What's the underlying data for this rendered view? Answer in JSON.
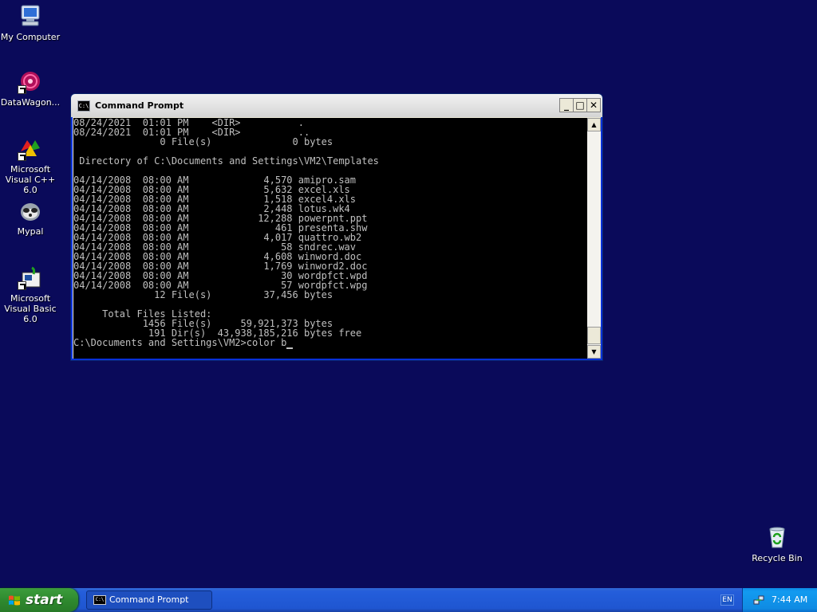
{
  "desktop": {
    "icons": [
      {
        "label": "My Computer",
        "icon": "my-computer-icon"
      },
      {
        "label": "DataWagon...",
        "icon": "datawagon-icon"
      },
      {
        "label": "Microsoft Visual C++ 6.0",
        "icon": "visual-cpp-icon"
      },
      {
        "label": "Mypal",
        "icon": "mypal-icon"
      },
      {
        "label": "Microsoft Visual Basic 6.0",
        "icon": "visual-basic-icon"
      },
      {
        "label": "Recycle Bin",
        "icon": "recycle-bin-icon"
      }
    ]
  },
  "window": {
    "title": "Command Prompt",
    "icon_text": "C:\\",
    "minimize": "_",
    "maximize": "□",
    "close": "✕",
    "console_text": "08/24/2021  01:01 PM    <DIR>          .\n08/24/2021  01:01 PM    <DIR>          ..\n               0 File(s)              0 bytes\n\n Directory of C:\\Documents and Settings\\VM2\\Templates\n\n04/14/2008  08:00 AM             4,570 amipro.sam\n04/14/2008  08:00 AM             5,632 excel.xls\n04/14/2008  08:00 AM             1,518 excel4.xls\n04/14/2008  08:00 AM             2,448 lotus.wk4\n04/14/2008  08:00 AM            12,288 powerpnt.ppt\n04/14/2008  08:00 AM               461 presenta.shw\n04/14/2008  08:00 AM             4,017 quattro.wb2\n04/14/2008  08:00 AM                58 sndrec.wav\n04/14/2008  08:00 AM             4,608 winword.doc\n04/14/2008  08:00 AM             1,769 winword2.doc\n04/14/2008  08:00 AM                30 wordpfct.wpd\n04/14/2008  08:00 AM                57 wordpfct.wpg\n              12 File(s)         37,456 bytes\n\n     Total Files Listed:\n            1456 File(s)     59,921,373 bytes\n             191 Dir(s)  43,938,185,216 bytes free\n",
    "prompt": "C:\\Documents and Settings\\VM2>color b",
    "scroll_up": "▲",
    "scroll_down": "▼"
  },
  "taskbar": {
    "start_label": "start",
    "tasks": [
      {
        "label": "Command Prompt",
        "icon_text": "C:\\"
      }
    ],
    "language": "EN",
    "clock": "7:44 AM"
  },
  "colors": {
    "desktop_bg": "#0a0a5a",
    "console_bg": "#000000",
    "console_fg": "#c0c0c0",
    "taskbar_blue": "#245edb",
    "start_green": "#2f8a2f"
  }
}
